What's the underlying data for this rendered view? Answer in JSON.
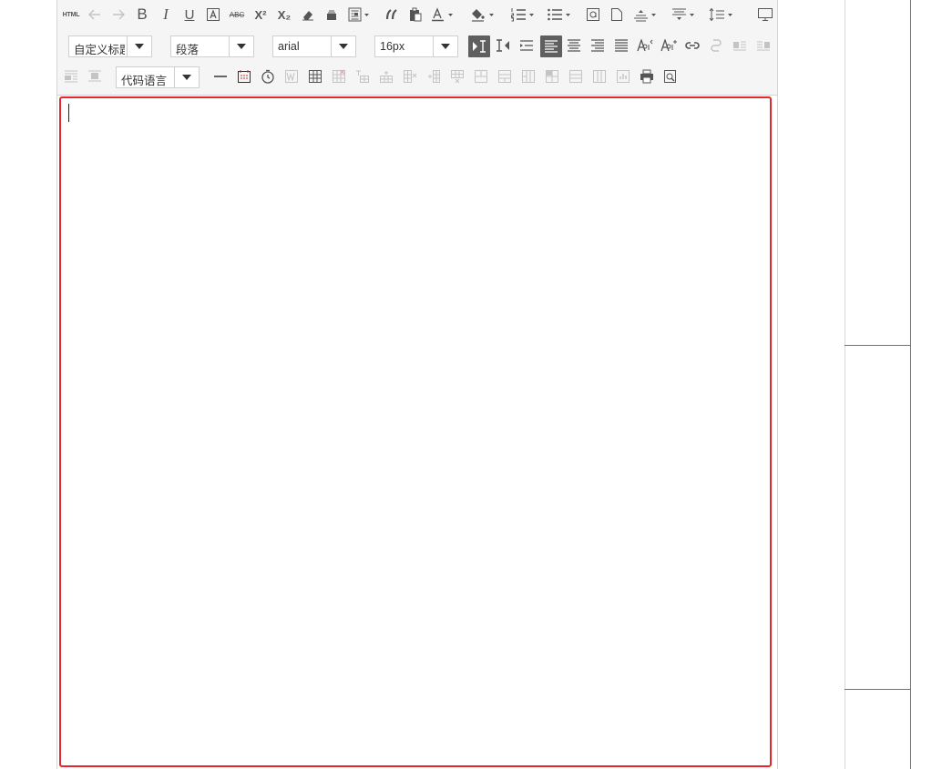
{
  "toolbar": {
    "html_label": "HTML",
    "bold_label": "B",
    "italic_label": "I",
    "underline_label": "U",
    "strike_label": "ABC",
    "superscript_label": "X²",
    "subscript_label": "X₂",
    "custom_heading": "自定义标题",
    "paragraph_format": "段落",
    "font_family": "arial",
    "font_size": "16px",
    "code_language": "代码语言"
  },
  "colors": {
    "editor_border": "#e5282d",
    "toolbar_bg": "#f5f5f5",
    "selected_button": "#5f5f5f",
    "divider_purple": "#7b5fbd"
  }
}
